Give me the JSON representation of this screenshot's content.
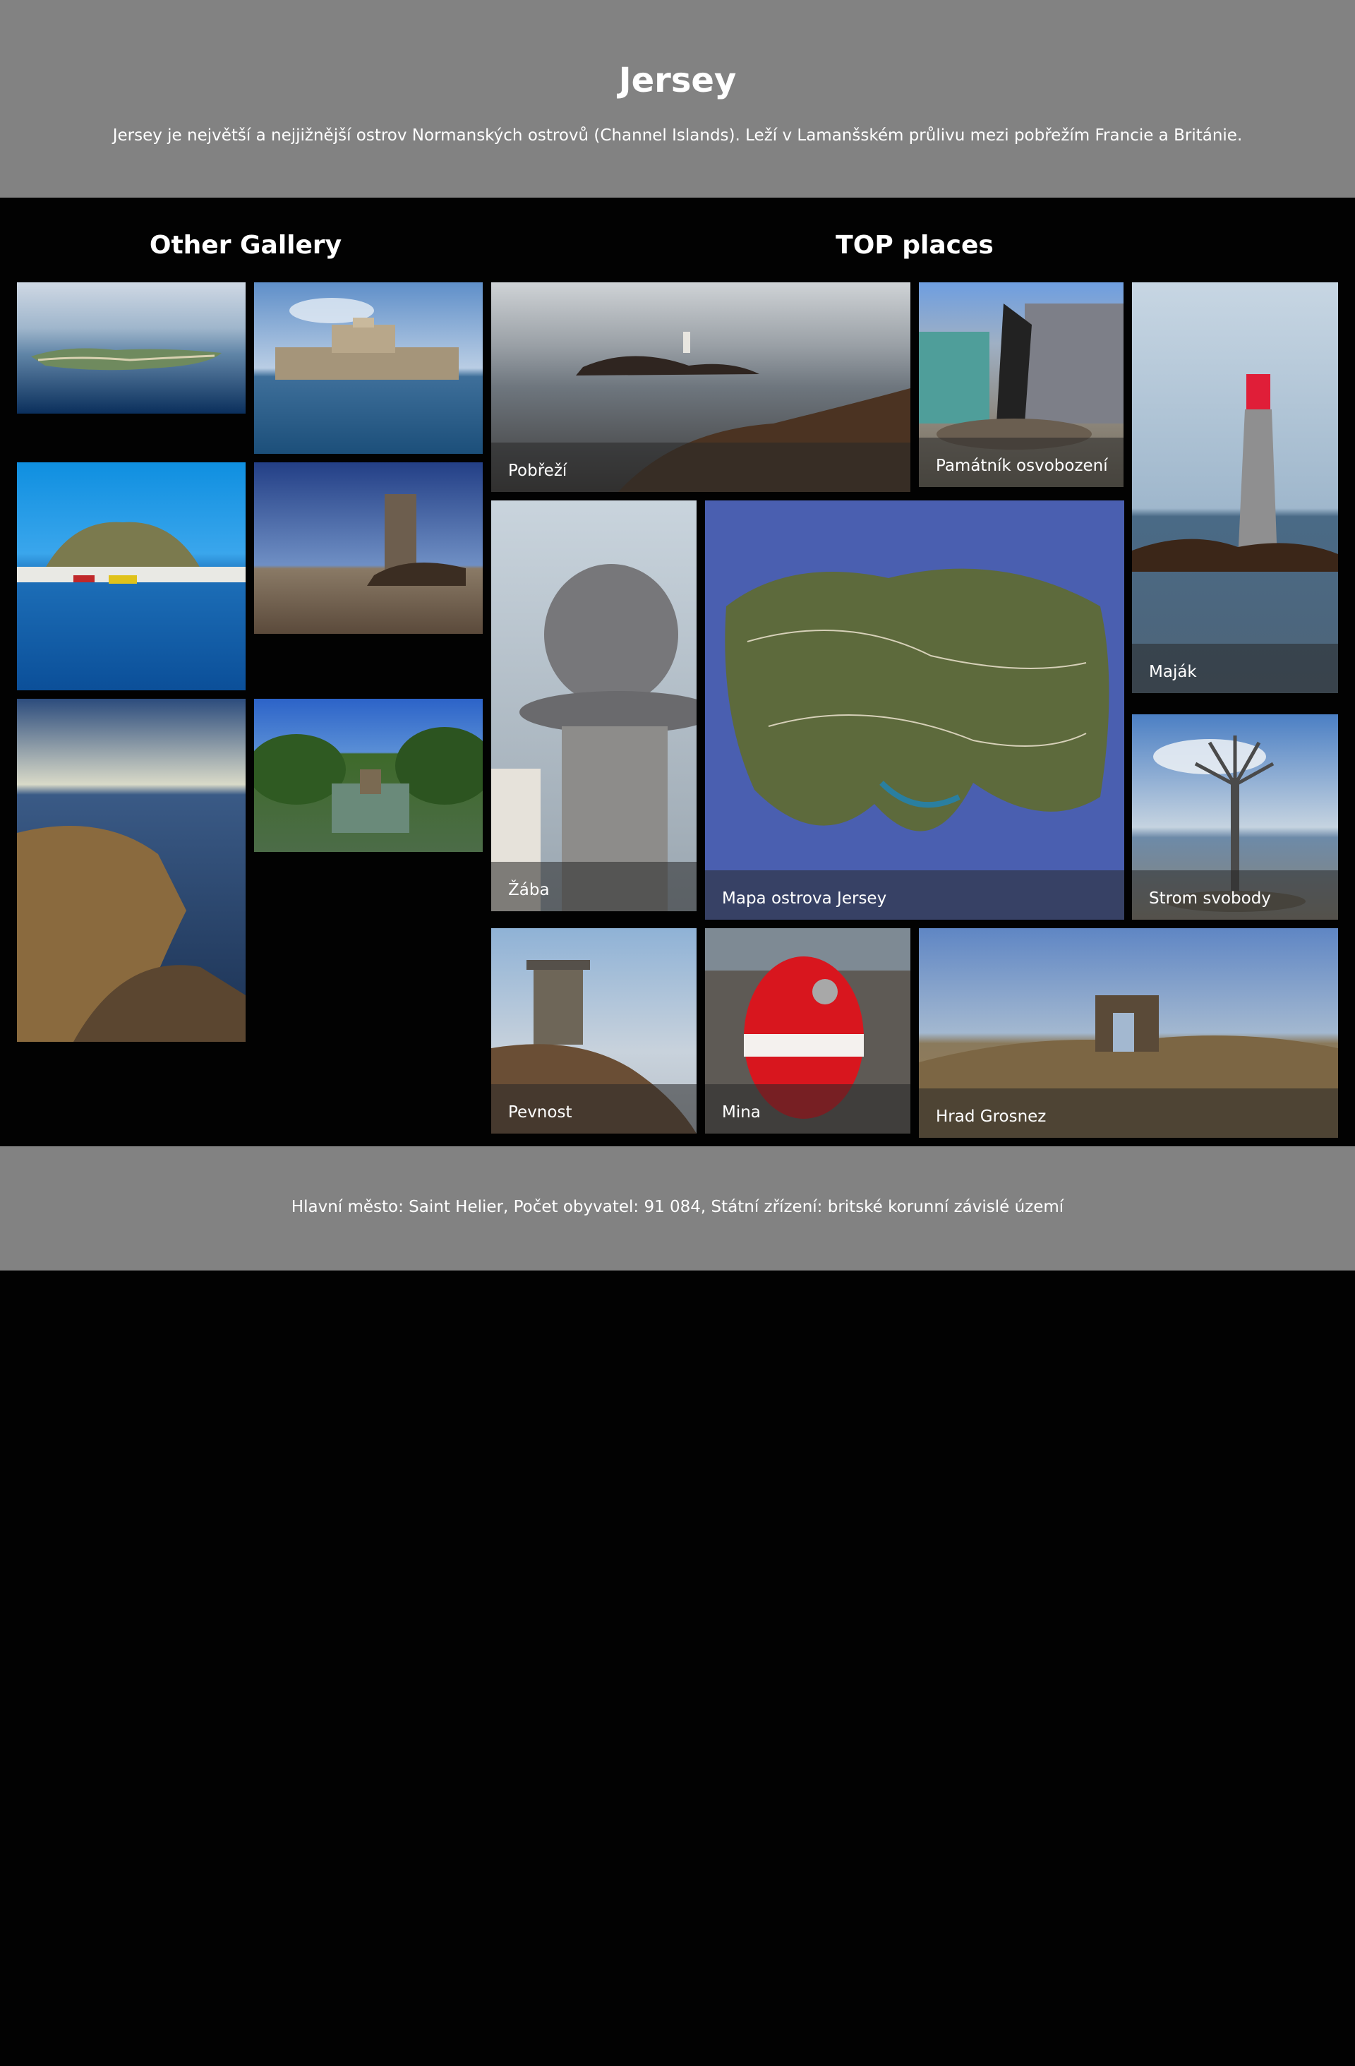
{
  "header": {
    "title": "Jersey",
    "description": "Jersey je největší a nejjižnější ostrov Normanských ostrovů (Channel Islands). Leží v Lamanšském průlivu mezi pobřežím Francie a Británie."
  },
  "gallery": {
    "title": "Other Gallery"
  },
  "top_places": {
    "title": "TOP places",
    "items": [
      {
        "label": "Pobřeží"
      },
      {
        "label": "Památník osvobození"
      },
      {
        "label": "Maják"
      },
      {
        "label": "Žába"
      },
      {
        "label": "Mapa ostrova Jersey"
      },
      {
        "label": "Strom svobody"
      },
      {
        "label": "Pevnost"
      },
      {
        "label": "Mina"
      },
      {
        "label": "Hrad Grosnez"
      }
    ]
  },
  "footer": {
    "text": "Hlavní město: Saint Helier, Počet obyvatel: 91 084, Státní zřízení: britské korunní závislé území"
  },
  "colors": {
    "header_bg": "#828282",
    "page_bg": "#020202",
    "footer_bg": "#828282"
  }
}
